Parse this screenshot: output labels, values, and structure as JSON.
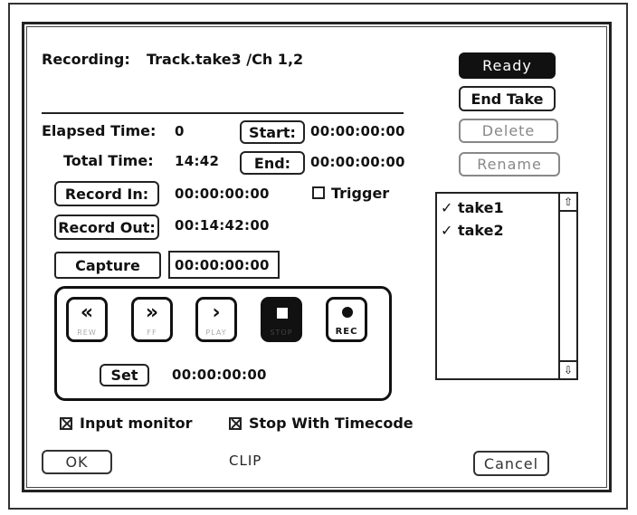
{
  "recording": {
    "label": "Recording:",
    "value": "Track.take3 /Ch 1,2"
  },
  "side_buttons": {
    "ready": "Ready",
    "end_take": "End Take",
    "delete": "Delete",
    "rename": "Rename"
  },
  "elapsed": {
    "label": "Elapsed Time:",
    "value": "0"
  },
  "total": {
    "label": "Total Time:",
    "value": "14:42"
  },
  "start": {
    "button": "Start:",
    "value": "00:00:00:00"
  },
  "end": {
    "button": "End:",
    "value": "00:00:00:00"
  },
  "record_in": {
    "button": "Record In:",
    "value": "00:00:00:00"
  },
  "record_out": {
    "button": "Record Out:",
    "value": "00:14:42:00"
  },
  "trigger": {
    "label": "Trigger",
    "checked": false
  },
  "capture": {
    "button": "Capture",
    "value": "00:00:00:00"
  },
  "transport": {
    "rew": {
      "glyph": "«",
      "caption": "REW"
    },
    "ff": {
      "glyph": "»",
      "caption": "FF"
    },
    "play": {
      "glyph": "›",
      "caption": "PLAY"
    },
    "stop": {
      "caption": "STOP"
    },
    "rec": {
      "caption": "REC"
    }
  },
  "set": {
    "button": "Set",
    "value": "00:00:00:00"
  },
  "takes": [
    {
      "check": "✓",
      "name": "take1"
    },
    {
      "check": "✓",
      "name": "take2"
    }
  ],
  "options": {
    "input_monitor": {
      "label": "Input monitor",
      "checked": true
    },
    "stop_with_timecode": {
      "label": "Stop With Timecode",
      "checked": true
    }
  },
  "footer": {
    "ok": "OK",
    "clip": "CLIP",
    "cancel": "Cancel"
  }
}
